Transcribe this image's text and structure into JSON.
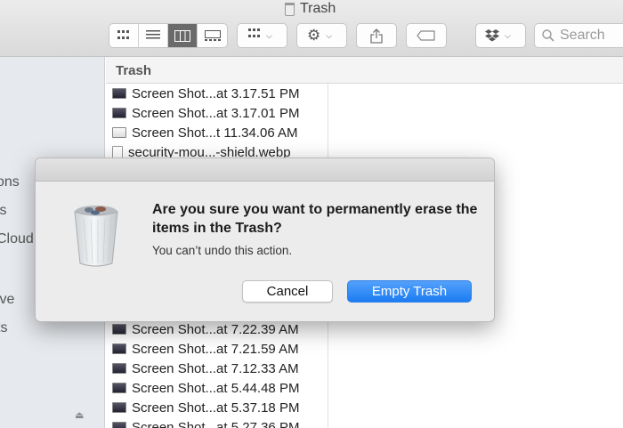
{
  "window": {
    "title": "Trash"
  },
  "toolbar": {
    "view_icons": [
      "grid-view-icon",
      "list-view-icon",
      "column-view-icon",
      "gallery-view-icon"
    ],
    "group_icon": "group-icon",
    "action_icon": "gear-icon",
    "share_icon": "share-icon",
    "tag_icon": "tag-icon",
    "dropbox_icon": "dropbox-icon",
    "search_placeholder": "Search"
  },
  "sidebar": {
    "items": [
      {
        "label": "ons"
      },
      {
        "label": "ls"
      },
      {
        "label": "Cloud"
      },
      {
        "label": "ive"
      },
      {
        "label": "ts"
      }
    ]
  },
  "column": {
    "header": "Trash",
    "files_top": [
      {
        "name": "Screen Shot...at 3.17.51 PM",
        "thumb": "dark"
      },
      {
        "name": "Screen Shot...at 3.17.01 PM",
        "thumb": "dark"
      },
      {
        "name": "Screen Shot...t 11.34.06 AM",
        "thumb": "light"
      },
      {
        "name": "security-mou...-shield.webp",
        "thumb": "doc"
      }
    ],
    "files_bottom": [
      {
        "name": "Screen Shot...at 7.22.39 AM",
        "thumb": "dark"
      },
      {
        "name": "Screen Shot...at 7.21.59 AM",
        "thumb": "dark"
      },
      {
        "name": "Screen Shot...at 7.12.33 AM",
        "thumb": "dark"
      },
      {
        "name": "Screen Shot...at 5.44.48 PM",
        "thumb": "dark"
      },
      {
        "name": "Screen Shot...at 5.37.18 PM",
        "thumb": "dark"
      },
      {
        "name": "Screen Shot...at 5.27.36 PM",
        "thumb": "dark"
      }
    ]
  },
  "dialog": {
    "title": "Are you sure you want to permanently erase the items in the Trash?",
    "message": "You can’t undo this action.",
    "cancel_label": "Cancel",
    "confirm_label": "Empty Trash",
    "accent_color": "#1c7cf3"
  }
}
